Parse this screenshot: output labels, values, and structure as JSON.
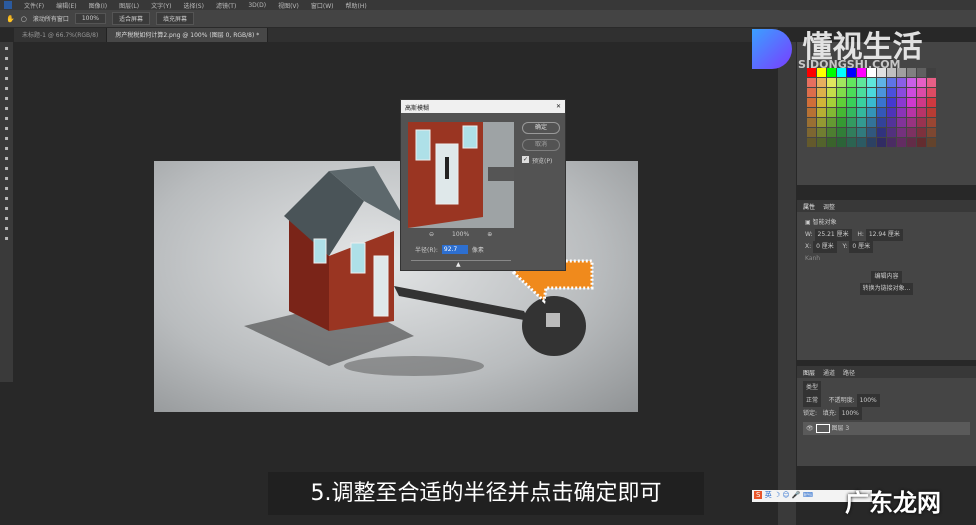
{
  "menu": [
    "文件(F)",
    "编辑(E)",
    "图像(I)",
    "图层(L)",
    "文字(Y)",
    "选择(S)",
    "滤镜(T)",
    "3D(D)",
    "视图(V)",
    "窗口(W)",
    "帮助(H)"
  ],
  "options": {
    "scroll_all": "滚动所有窗口",
    "zoom": "100%",
    "fit": "适合屏幕",
    "fill": "填充屏幕"
  },
  "tabs": [
    "未标题-1 @ 66.7%(RGB/8)",
    "房产税税如何计算2.png @ 100% (图层 0, RGB/8) *"
  ],
  "dialog": {
    "title": "高斯模糊",
    "ok": "确定",
    "cancel": "取消",
    "preview": "预览(P)",
    "zoom": "100%",
    "radius_label": "半径(R):",
    "radius": "92.7",
    "unit": "像素",
    "slider": 0.45
  },
  "properties": {
    "tab1": "属性",
    "tab2": "调整",
    "type": "智能对象",
    "w_label": "W:",
    "w": "25.21 厘米",
    "h_label": "H:",
    "h": "12.94 厘米",
    "x_label": "X:",
    "x": "0 厘米",
    "y_label": "Y:",
    "y": "0 厘米",
    "file": "Kanh",
    "button1": "编辑内容",
    "button2": "转换为链接对象..."
  },
  "layers": {
    "tabs": [
      "图层",
      "通道",
      "路径"
    ],
    "filter": "类型",
    "blend": "正常",
    "opacity_label": "不透明度:",
    "opacity": "100%",
    "lock_label": "锁定:",
    "fill_label": "填充:",
    "fill": "100%",
    "layer_name": "图层 3"
  },
  "caption": "5.调整至合适的半径并点击确定即可",
  "watermark": {
    "brand": "懂视生活",
    "url": "SIDONGSHI.COM",
    "site": "广东龙网"
  },
  "ime": "英"
}
